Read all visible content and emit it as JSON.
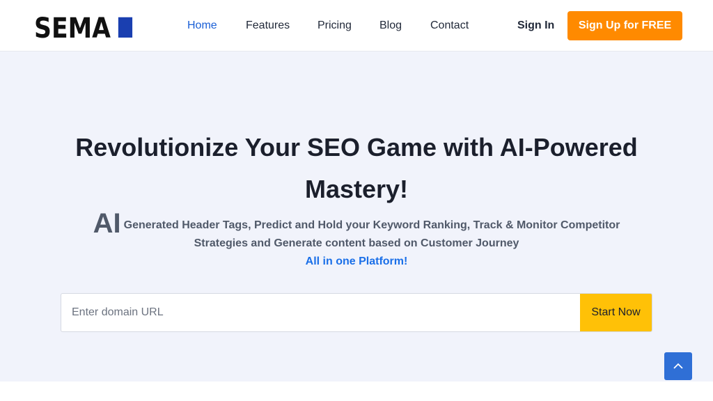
{
  "brand": {
    "logo_text": "SEMAI"
  },
  "nav": {
    "items": [
      {
        "label": "Home",
        "active": true
      },
      {
        "label": "Features"
      },
      {
        "label": "Pricing"
      },
      {
        "label": "Blog"
      },
      {
        "label": "Contact"
      }
    ],
    "signin_label": "Sign In",
    "signup_label": "Sign Up for FREE"
  },
  "hero": {
    "headline": "Revolutionize Your SEO Game with AI-Powered Mastery!",
    "sub_prefix": "AI",
    "sub_text": "Generated Header Tags, Predict and Hold your Keyword Ranking, Track & Monitor Competitor Strategies and Generate content based on Customer Journey",
    "sub_accent": "All in one Platform!"
  },
  "search": {
    "placeholder": "Enter domain URL",
    "value": "",
    "button_label": "Start Now"
  },
  "scroll_top": {
    "icon": "chevron-up-icon"
  },
  "colors": {
    "primary": "#1a5fd6",
    "cta": "#ff8a00",
    "start_button": "#ffc107",
    "hero_bg": "#f1f3fb",
    "scroll_button": "#2f6fd6"
  }
}
